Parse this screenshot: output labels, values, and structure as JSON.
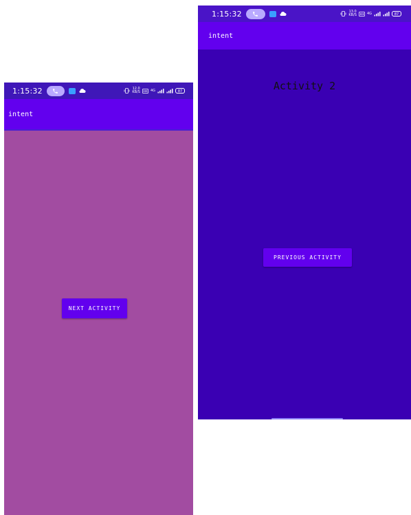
{
  "theme": {
    "left_background": "#a24ca1",
    "right_background": "#3a00b3",
    "app_bar": "#6200ee",
    "status_bar_left": "#3f17b8",
    "status_bar_right": "#4a14c7",
    "button": "#6200ee",
    "call_pill": "#b9a9ff"
  },
  "left_screen": {
    "status_bar": {
      "time": "1:15:32",
      "call_icon": "phone-call-icon",
      "net_speed_top": "12.0",
      "net_speed_bottom": "KB/S",
      "network_label": "4G",
      "battery": "87"
    },
    "app_bar": {
      "title": "intent"
    },
    "button": {
      "label": "NEXT ACTIVITY"
    }
  },
  "right_screen": {
    "status_bar": {
      "time": "1:15:32",
      "call_icon": "phone-call-icon",
      "net_speed_top": "13.0",
      "net_speed_bottom": "KB/S",
      "network_label": "4G",
      "battery": "87"
    },
    "app_bar": {
      "title": "intent"
    },
    "heading": "Activity 2",
    "button": {
      "label": "PREVIOUS ACTIVITY"
    }
  }
}
